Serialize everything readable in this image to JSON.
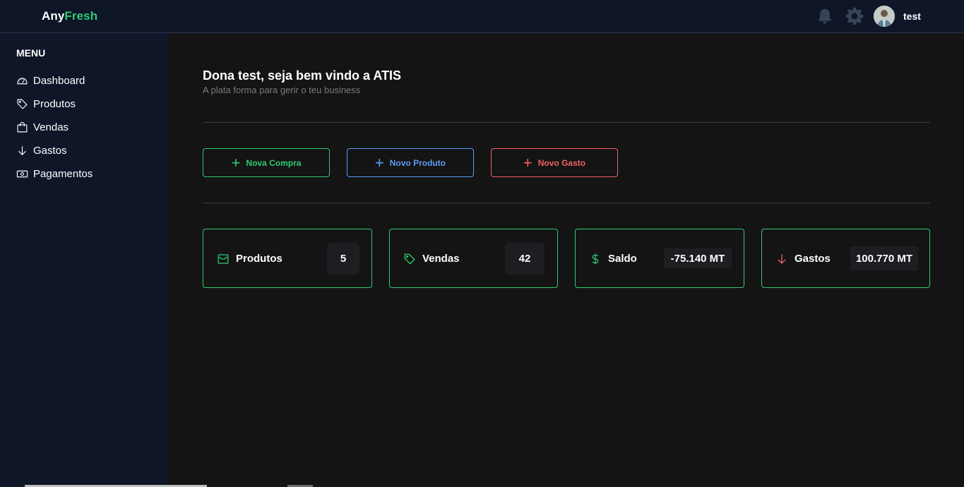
{
  "header": {
    "logo_part1": "Any",
    "logo_part2": "Fresh",
    "username": "test",
    "icons": [
      "bell-icon",
      "gear-icon"
    ]
  },
  "sidebar": {
    "menu_title": "MENU",
    "items": [
      {
        "label": "Dashboard",
        "icon": "gauge-icon"
      },
      {
        "label": "Produtos",
        "icon": "tag-icon"
      },
      {
        "label": "Vendas",
        "icon": "shopping-bag-icon"
      },
      {
        "label": "Gastos",
        "icon": "arrow-down-icon"
      },
      {
        "label": "Pagamentos",
        "icon": "banknote-icon"
      }
    ]
  },
  "main": {
    "greeting": "Dona test, seja bem vindo a ATIS",
    "subtitle": "A plata forma para gerir o teu business",
    "actions": [
      {
        "label": "Nova Compra",
        "color": "#2ecc71"
      },
      {
        "label": "Novo Produto",
        "color": "#5b9cf5"
      },
      {
        "label": "Novo Gasto",
        "color": "#f26161"
      }
    ],
    "cards": [
      {
        "label": "Produtos",
        "value": "5",
        "icon": "inbox-icon",
        "icon_color": "#2ecc71"
      },
      {
        "label": "Vendas",
        "value": "42",
        "icon": "tag-icon",
        "icon_color": "#2ecc71"
      },
      {
        "label": "Saldo",
        "value": "-75.140 MT",
        "icon": "dollar-icon",
        "icon_color": "#2ecc71"
      },
      {
        "label": "Gastos",
        "value": "100.770 MT",
        "icon": "arrow-down-icon",
        "icon_color": "#f26161"
      }
    ]
  },
  "colors": {
    "accent": "#2ecc71",
    "blue": "#5b9cf5",
    "red": "#f26161",
    "sidebar_bg": "#0e1628",
    "main_bg": "#141414"
  }
}
